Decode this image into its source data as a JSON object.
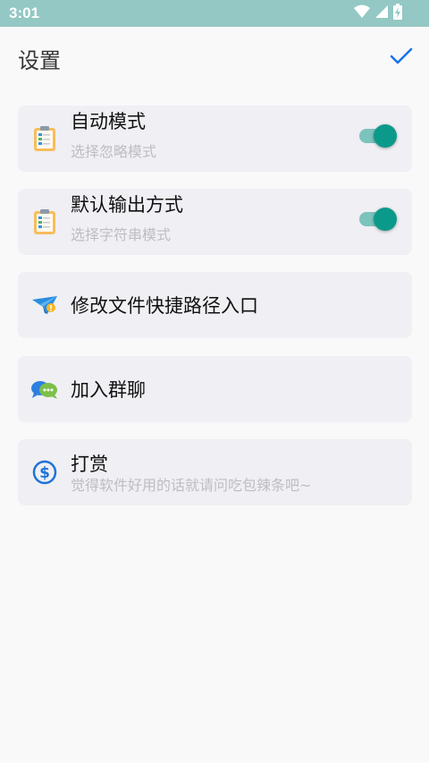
{
  "status_bar": {
    "time": "3:01",
    "icons": [
      "wifi-icon",
      "cellular-signal-icon",
      "battery-icon"
    ]
  },
  "header": {
    "title": "设置",
    "confirm_icon": "checkmark-icon"
  },
  "settings": [
    {
      "title": "自动模式",
      "subtitle": "选择忽略模式",
      "icon": "clipboard-icon",
      "toggle_on": true
    },
    {
      "title": "默认输出方式",
      "subtitle": "选择字符串模式",
      "icon": "clipboard-icon",
      "toggle_on": true
    },
    {
      "title": "修改文件快捷路径入口",
      "icon": "paper-plane-icon"
    },
    {
      "title": "加入群聊",
      "icon": "chat-bubbles-icon"
    },
    {
      "title": "打赏",
      "subtitle": "觉得软件好用的话就请问吃包辣条吧~",
      "icon": "dollar-circle-icon"
    }
  ],
  "colors": {
    "status_bar": "#93c8c4",
    "accent": "#0b9a8a",
    "toggle_track": "#7cc2bd",
    "card_bg": "#efeff4",
    "confirm_check": "#1a73e8"
  }
}
